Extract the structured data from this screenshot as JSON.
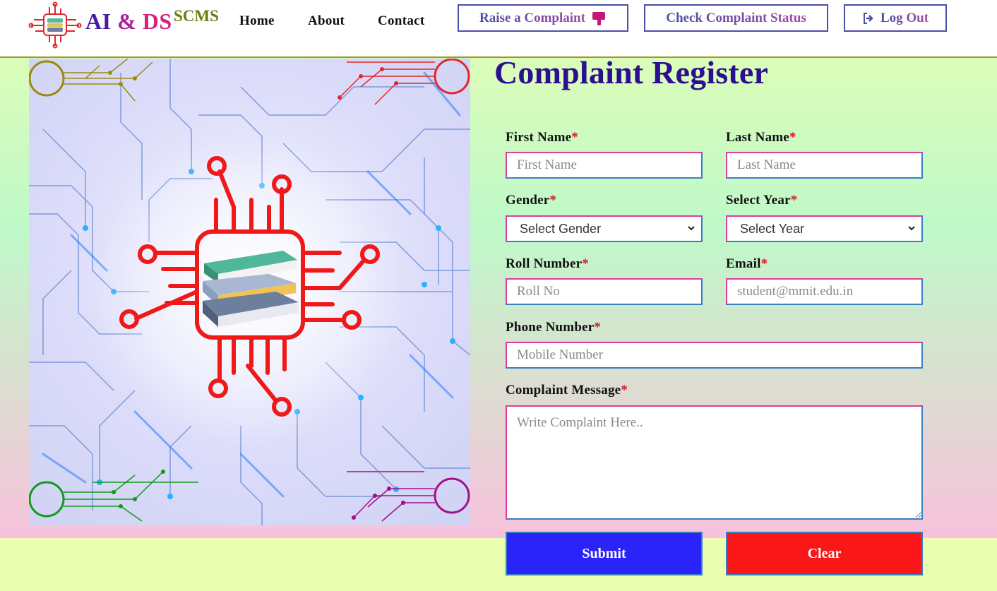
{
  "header": {
    "brand": {
      "ai": "AI",
      "amp": "&",
      "ds": "DS",
      "sup": "SCMS"
    },
    "nav": [
      {
        "label": "Home"
      },
      {
        "label": "About"
      },
      {
        "label": "Contact"
      }
    ],
    "buttons": {
      "raise": "Raise a Complaint",
      "status": "Check Complaint Status",
      "logout": "Log Out"
    },
    "icons": {
      "raise": "thumbs-down-icon",
      "logout": "sign-out-icon"
    }
  },
  "form": {
    "title": "Complaint Register",
    "required_mark": "*",
    "first_name": {
      "label": "First Name",
      "placeholder": "First Name"
    },
    "last_name": {
      "label": "Last Name",
      "placeholder": "Last Name"
    },
    "gender": {
      "label": "Gender",
      "selected": "Select Gender"
    },
    "year": {
      "label": "Select Year",
      "selected": "Select Year"
    },
    "roll": {
      "label": "Roll Number",
      "placeholder": "Roll No"
    },
    "email": {
      "label": "Email",
      "placeholder": "student@mmit.edu.in"
    },
    "phone": {
      "label": "Phone Number",
      "placeholder": "Mobile Number"
    },
    "message": {
      "label": "Complaint Message",
      "placeholder": "Write Complaint Here.."
    },
    "submit": "Submit",
    "clear": "Clear"
  },
  "colors": {
    "brand_purple": "#4a1aa6",
    "title": "#2c0f8f",
    "submit_bg": "#2a24fb",
    "clear_bg": "#fb1717",
    "field_border": "#e03c9c"
  }
}
